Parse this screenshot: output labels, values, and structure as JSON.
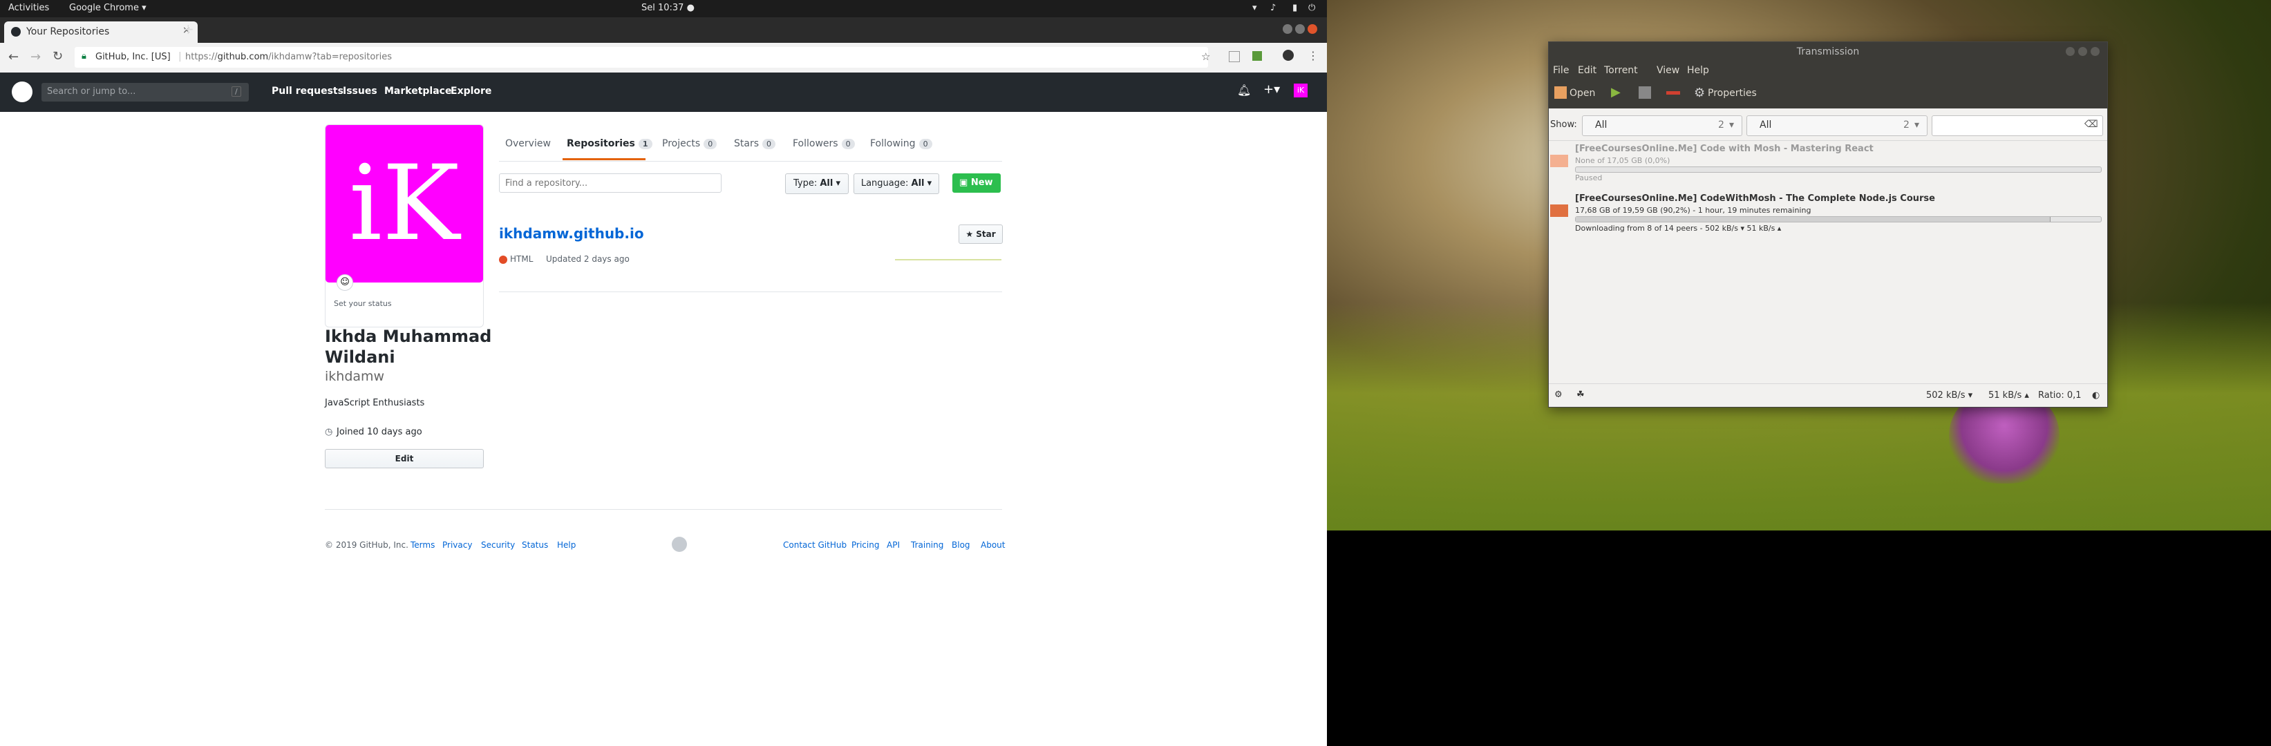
{
  "topbar": {
    "activities": "Activities",
    "app": "Google Chrome ▾",
    "clock": "Sel 10:37 ●"
  },
  "chrome": {
    "tab_title": "Your Repositories",
    "tab_close": "×",
    "new_tab": "+",
    "secure_label": "GitHub, Inc. [US]",
    "url_prefix": "https://",
    "url_host": "github.com",
    "url_path": "/ikhdamw?tab=repositories"
  },
  "github": {
    "search_placeholder": "Search or jump to...",
    "search_key": "/",
    "nav": [
      "Pull requests",
      "Issues",
      "Marketplace",
      "Explore"
    ],
    "avatar_text": "iK",
    "set_status": "Set your status",
    "full_name_line1": "Ikhda Muhammad",
    "full_name_line2": "Wildani",
    "username": "ikhdamw",
    "bio": "JavaScript Enthusiasts",
    "joined": "Joined 10 days ago",
    "edit_label": "Edit",
    "tabs": [
      {
        "label": "Overview",
        "count": ""
      },
      {
        "label": "Repositories",
        "count": "1"
      },
      {
        "label": "Projects",
        "count": "0"
      },
      {
        "label": "Stars",
        "count": "0"
      },
      {
        "label": "Followers",
        "count": "0"
      },
      {
        "label": "Following",
        "count": "0"
      }
    ],
    "find_placeholder": "Find a repository...",
    "type_label": "Type:",
    "type_value": "All",
    "language_label": "Language:",
    "language_value": "All",
    "new_label": "New",
    "repo": {
      "name": "ikhdamw.github.io",
      "language": "HTML",
      "language_color": "#e34c26",
      "updated": "Updated 2 days ago",
      "star_label": "Star"
    },
    "footer": {
      "copyright": "© 2019 GitHub, Inc.",
      "left_links": [
        "Terms",
        "Privacy",
        "Security",
        "Status",
        "Help"
      ],
      "right_links": [
        "Contact GitHub",
        "Pricing",
        "API",
        "Training",
        "Blog",
        "About"
      ]
    }
  },
  "transmission": {
    "title": "Transmission",
    "menu": [
      "File",
      "Edit",
      "Torrent",
      "View",
      "Help"
    ],
    "open_label": "Open",
    "properties_label": "Properties",
    "show_label": "Show:",
    "filter1": {
      "value": "All",
      "count": "2"
    },
    "filter2": {
      "value": "All",
      "count": "2"
    },
    "torrents": [
      {
        "name": "[FreeCoursesOnline.Me] Code with Mosh - Mastering React",
        "size": "None of 17,05 GB (0,0%)",
        "status": "Paused",
        "progress": 0.0
      },
      {
        "name": "[FreeCoursesOnline.Me] CodeWithMosh - The Complete Node.js Course",
        "size": "17,68 GB of 19,59 GB (90,2%) - 1 hour, 19 minutes remaining",
        "status": "Downloading from 8 of 14 peers - 502 kB/s ▾  51 kB/s ▴",
        "progress": 0.902
      }
    ],
    "down_speed": "502 kB/s ▾",
    "up_speed": "51 kB/s ▴",
    "ratio": "Ratio: 0,1"
  },
  "colors": {
    "github_dark": "#24292e",
    "avatar_bg": "#ff00ff",
    "new_green": "#2cbe4e",
    "tab_active": "#e36209"
  }
}
